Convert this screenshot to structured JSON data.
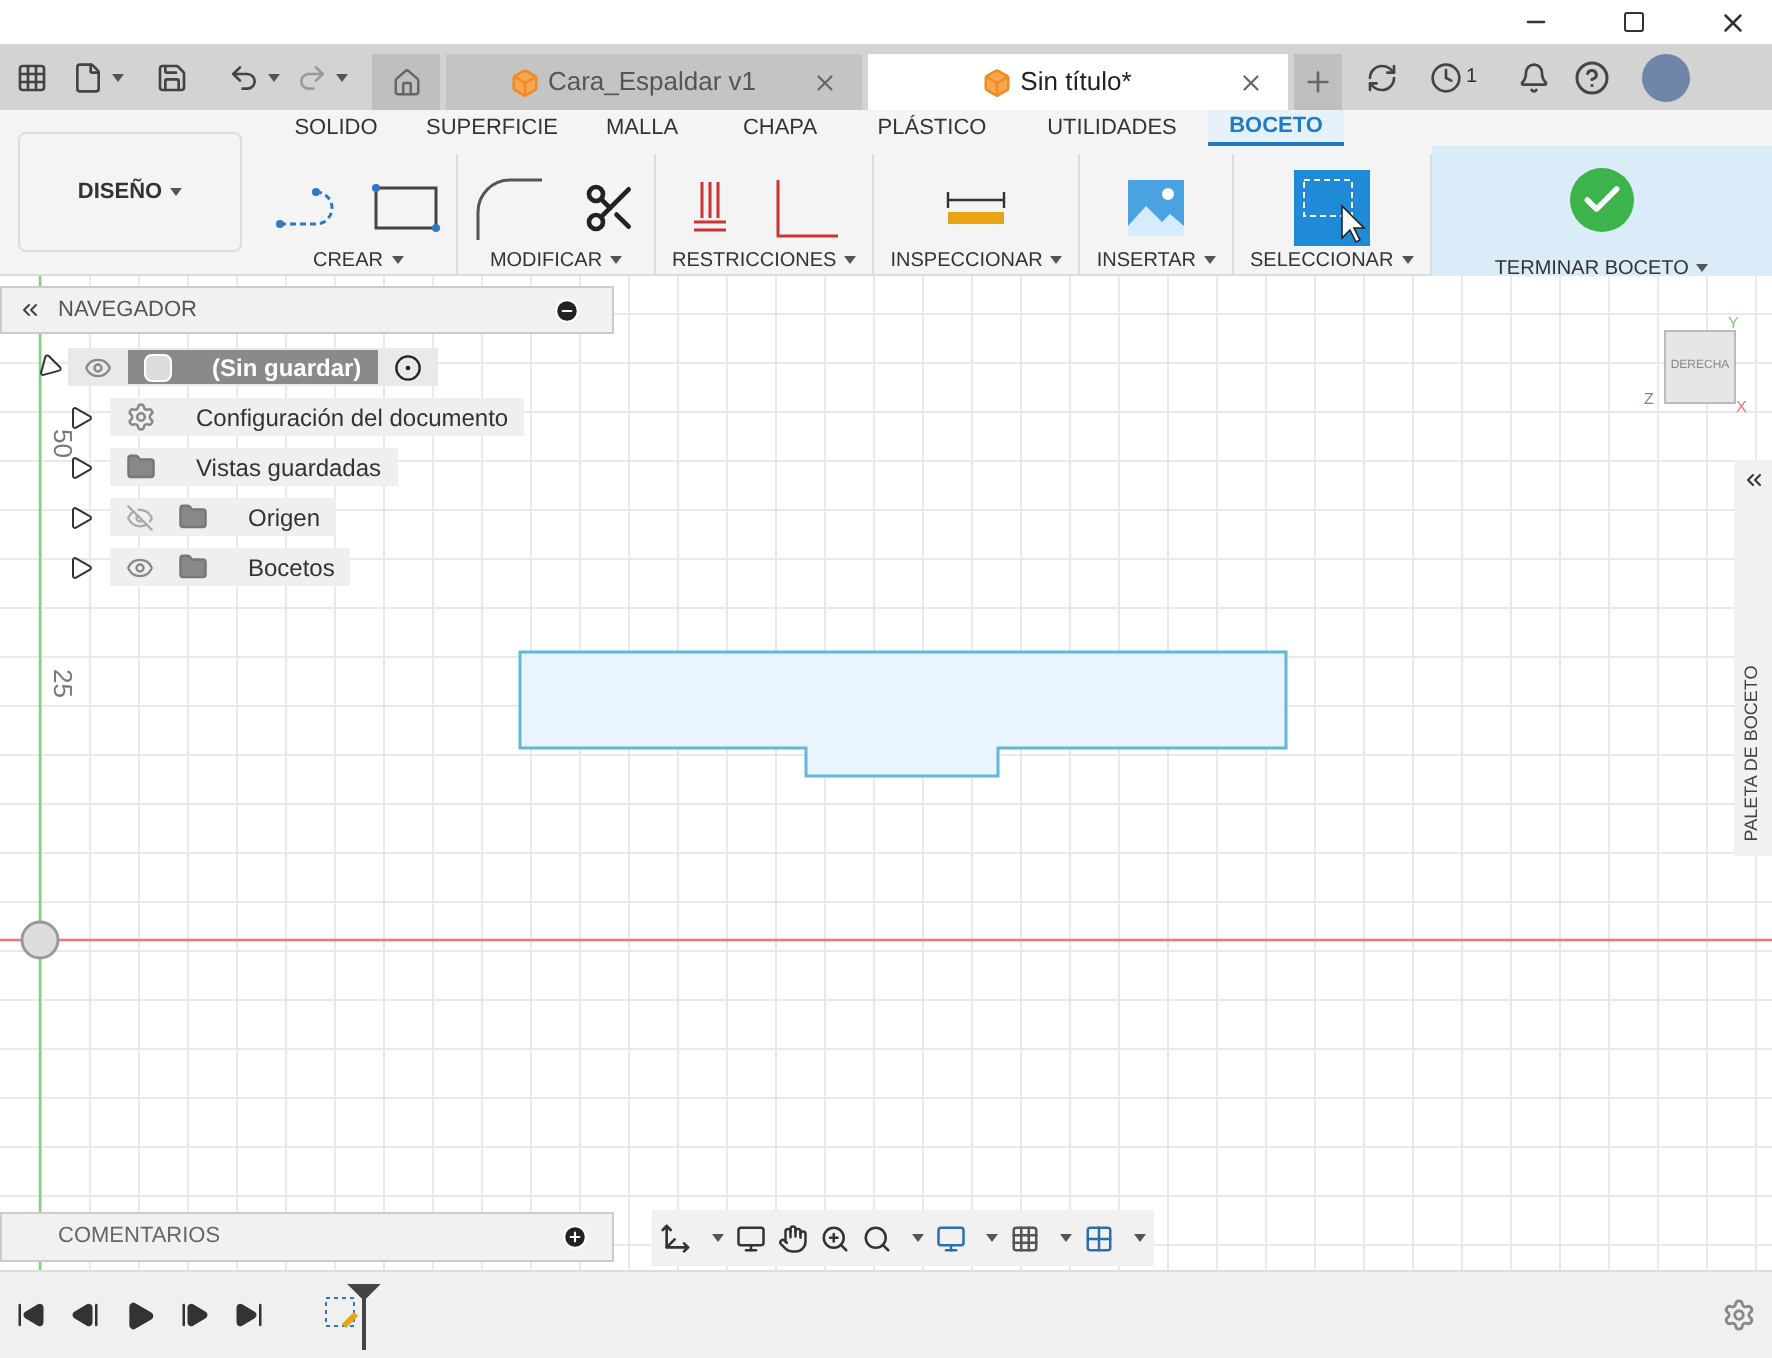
{
  "tabs": [
    {
      "label": "Cara_Espaldar v1",
      "selected": false
    },
    {
      "label": "Sin título*",
      "selected": true
    }
  ],
  "job_count": "1",
  "workspace": "DISEÑO",
  "ribbon_tabs": [
    {
      "label": "SOLIDO",
      "selected": false
    },
    {
      "label": "SUPERFICIE",
      "selected": false
    },
    {
      "label": "MALLA",
      "selected": false
    },
    {
      "label": "CHAPA",
      "selected": false
    },
    {
      "label": "PLÁSTICO",
      "selected": false
    },
    {
      "label": "UTILIDADES",
      "selected": false
    },
    {
      "label": "BOCETO",
      "selected": true
    }
  ],
  "ribbon_groups": [
    {
      "label": "CREAR",
      "kind": "create",
      "highlighted": false
    },
    {
      "label": "MODIFICAR",
      "kind": "modify",
      "highlighted": false
    },
    {
      "label": "RESTRICCIONES",
      "kind": "constraints",
      "highlighted": false
    },
    {
      "label": "INSPECCIONAR",
      "kind": "inspect",
      "highlighted": false
    },
    {
      "label": "INSERTAR",
      "kind": "insert",
      "highlighted": false
    },
    {
      "label": "SELECCIONAR",
      "kind": "select",
      "highlighted": false
    },
    {
      "label": "TERMINAR BOCETO",
      "kind": "finish",
      "highlighted": true
    }
  ],
  "navigator": {
    "title": "NAVEGADOR",
    "root": {
      "label": "(Sin guardar)",
      "expanded": true,
      "children": [
        {
          "label": "Configuración del documento",
          "kind": "settings",
          "expanded": false
        },
        {
          "label": "Vistas guardadas",
          "kind": "folder",
          "expanded": false
        },
        {
          "label": "Origen",
          "kind": "hidden-folder",
          "expanded": false
        },
        {
          "label": "Bocetos",
          "kind": "visible-folder",
          "expanded": false
        }
      ]
    }
  },
  "ruler_labels": [
    "50",
    "25"
  ],
  "view_cube": {
    "face": "DERECHA",
    "axes": [
      "Y",
      "Z",
      "X"
    ]
  },
  "palette": {
    "title": "PALETA DE BOCETO"
  },
  "comments": {
    "title": "COMENTARIOS"
  }
}
